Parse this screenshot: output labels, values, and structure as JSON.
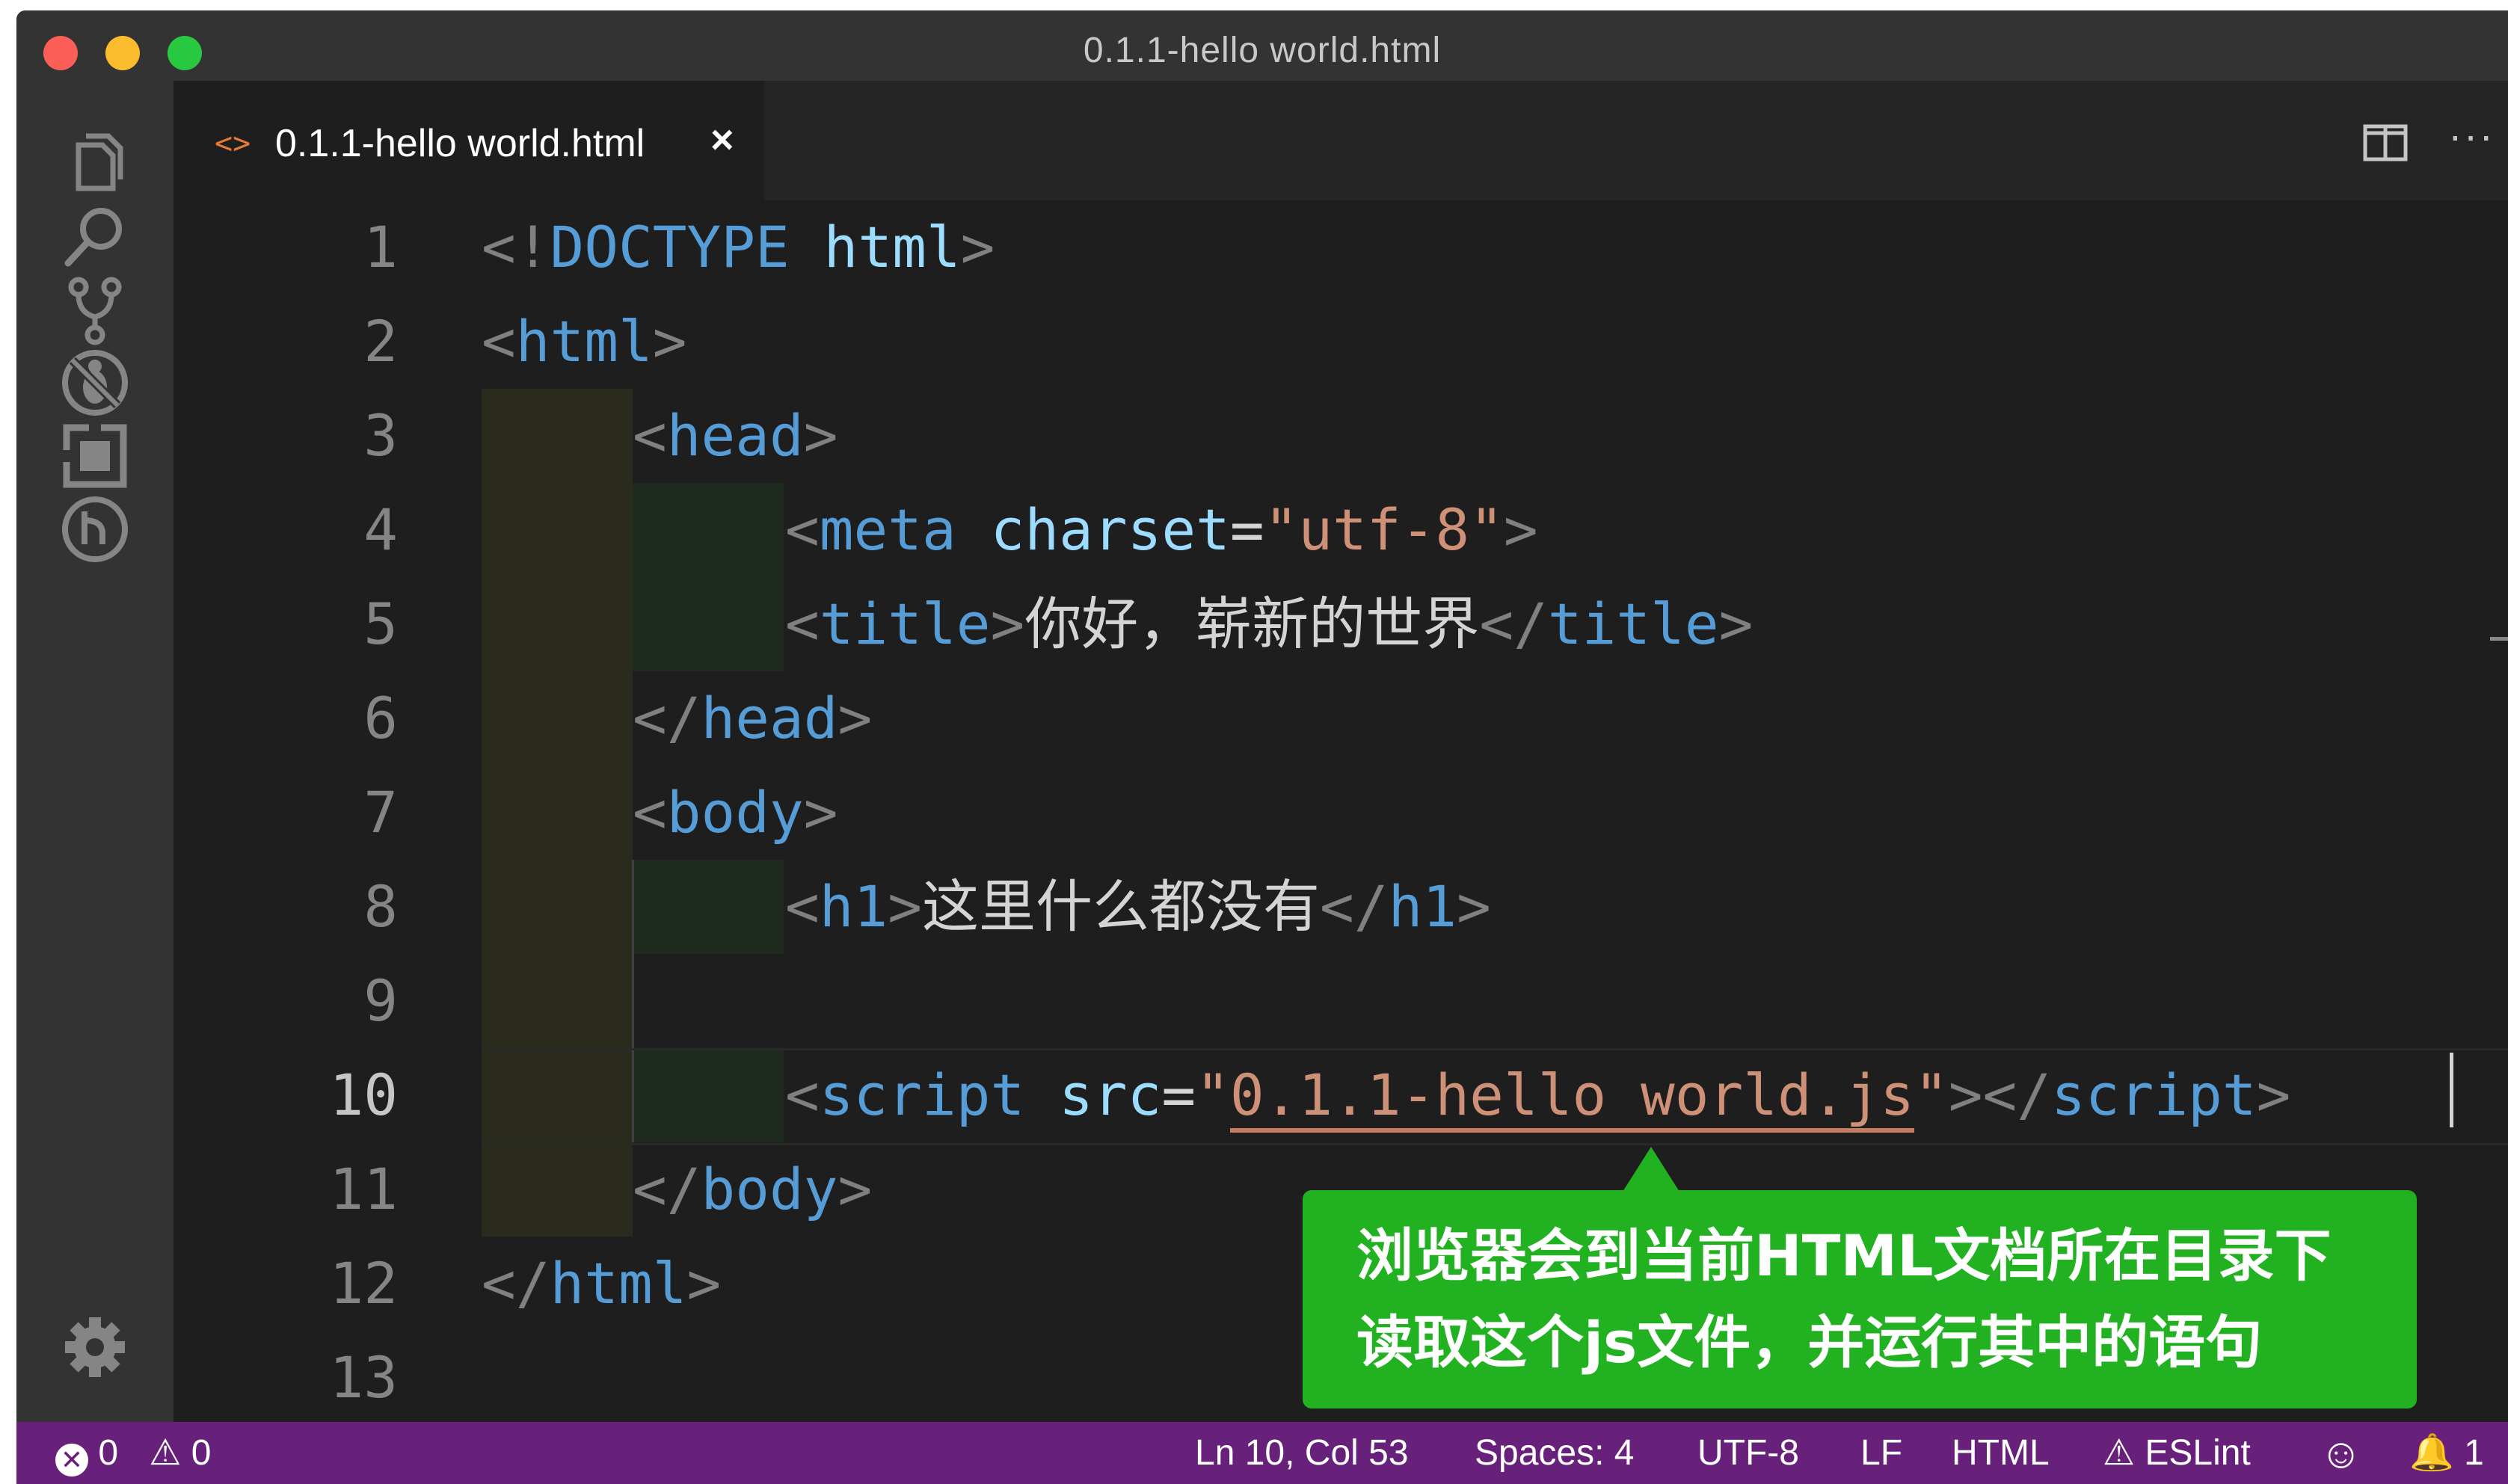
{
  "window": {
    "title": "0.1.1-hello world.html"
  },
  "activity_bar": {
    "icons": [
      "explorer-icon",
      "search-icon",
      "source-control-icon",
      "debug-icon",
      "extensions-icon",
      "remote-icon",
      "settings-gear-icon"
    ]
  },
  "tab": {
    "icon": "<>",
    "label": "0.1.1-hello world.html",
    "close": "×",
    "more": "···"
  },
  "editor": {
    "line_numbers": [
      "1",
      "2",
      "3",
      "4",
      "5",
      "6",
      "7",
      "8",
      "9",
      "10",
      "11",
      "12",
      "13"
    ],
    "active_line": "10",
    "code": {
      "l1": {
        "open": "<!",
        "doctype": "DOCTYPE",
        "space": " ",
        "html": "html",
        "close": ">"
      },
      "l2": {
        "open": "<",
        "tag": "html",
        "close": ">"
      },
      "l3": {
        "open": "<",
        "tag": "head",
        "close": ">"
      },
      "l4": {
        "open": "<",
        "tag": "meta",
        "attr": "charset",
        "eq": "=",
        "val": "\"utf-8\"",
        "close": ">"
      },
      "l5": {
        "open": "<",
        "tag": "title",
        "close": ">",
        "text": "你好，崭新的世界",
        "open2": "</",
        "tag2": "title",
        "close2": ">"
      },
      "l6": {
        "open": "</",
        "tag": "head",
        "close": ">"
      },
      "l7": {
        "open": "<",
        "tag": "body",
        "close": ">"
      },
      "l8": {
        "open": "<",
        "tag": "h1",
        "close": ">",
        "text": "这里什么都没有",
        "open2": "</",
        "tag2": "h1",
        "close2": ">"
      },
      "l10": {
        "open": "<",
        "tag": "script",
        "attr": "src",
        "eq": "=",
        "q1": "\"",
        "val": "0.1.1-hello world.js",
        "q2": "\"",
        "close": ">",
        "open2": "</",
        "tag2": "script",
        "close2": ">"
      },
      "l11": {
        "open": "</",
        "tag": "body",
        "close": ">"
      },
      "l12": {
        "open": "</",
        "tag": "html",
        "close": ">"
      }
    }
  },
  "callout": {
    "line1": "浏览器会到当前HTML文档所在目录下",
    "line2": "读取这个js文件，并运行其中的语句",
    "color": "#21b121"
  },
  "status_bar": {
    "errors": "0",
    "warnings": "0",
    "position": "Ln 10, Col 53",
    "spaces": "Spaces: 4",
    "encoding": "UTF-8",
    "eol": "LF",
    "language": "HTML",
    "eslint": "ESLint",
    "notifications": "1",
    "color": "#68217a"
  }
}
